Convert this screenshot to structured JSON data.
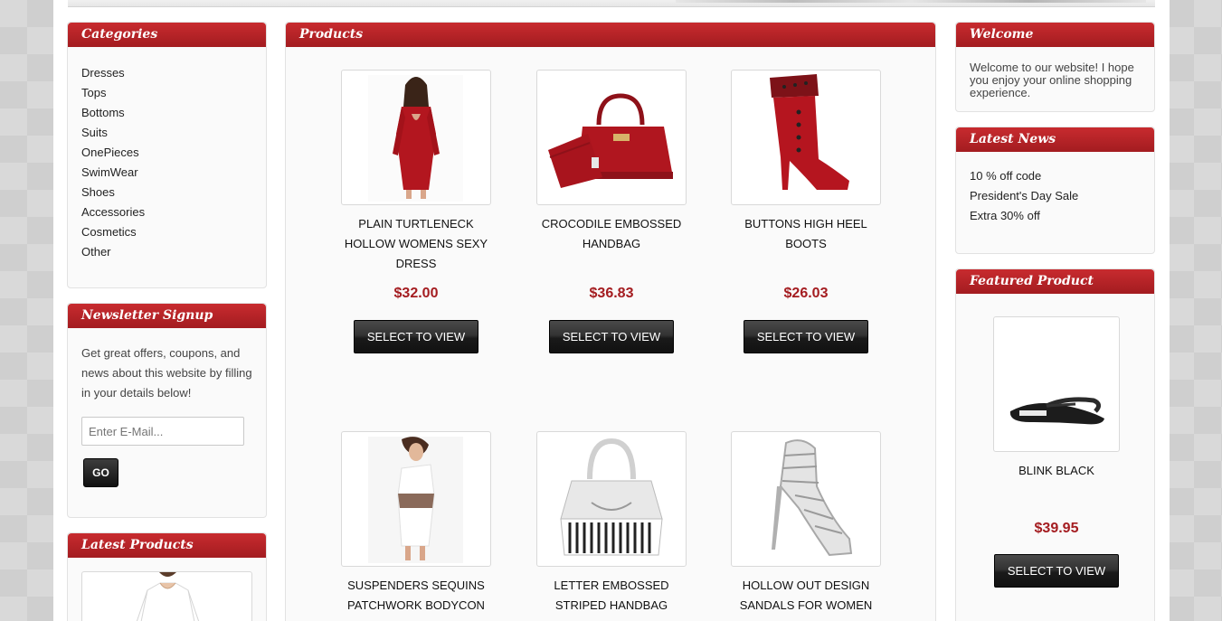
{
  "sidebar_left": {
    "categories": {
      "title": "Categories",
      "items": [
        "Dresses",
        "Tops",
        "Bottoms",
        "Suits",
        "OnePieces",
        "SwimWear",
        "Shoes",
        "Accessories",
        "Cosmetics",
        "Other"
      ]
    },
    "newsletter": {
      "title": "Newsletter Signup",
      "text": "Get great offers, coupons, and news about this website by filling in your details below!",
      "email_placeholder": "Enter E-Mail...",
      "go_label": "GO"
    },
    "latest_products": {
      "title": "Latest Products"
    }
  },
  "products": {
    "title": "Products",
    "button_label": "SELECT TO VIEW",
    "items": [
      {
        "name": "PLAIN TURTLENECK HOLLOW WOMENS SEXY DRESS",
        "price": "$32.00",
        "icon": "red-dress-image"
      },
      {
        "name": "CROCODILE EMBOSSED HANDBAG",
        "price": "$36.83",
        "icon": "red-handbag-image"
      },
      {
        "name": "BUTTONS HIGH HEEL BOOTS",
        "price": "$26.03",
        "icon": "red-boot-image"
      },
      {
        "name": "SUSPENDERS SEQUINS PATCHWORK BODYCON",
        "price": "",
        "icon": "white-dress-image"
      },
      {
        "name": "LETTER EMBOSSED STRIPED HANDBAG",
        "price": "",
        "icon": "striped-handbag-image"
      },
      {
        "name": "HOLLOW OUT DESIGN SANDALS FOR WOMEN",
        "price": "",
        "icon": "silver-sandal-image"
      }
    ]
  },
  "sidebar_right": {
    "welcome": {
      "title": "Welcome",
      "text": "Welcome to our website! I hope you enjoy your online shopping experience."
    },
    "latest_news": {
      "title": "Latest News",
      "items": [
        "10 % off code",
        "President's Day Sale",
        "Extra 30% off"
      ]
    },
    "featured": {
      "title": "Featured Product",
      "name": "BLINK BLACK",
      "price": "$39.95",
      "button_label": "SELECT TO VIEW",
      "icon": "black-flip-flop-image"
    }
  },
  "colors": {
    "header_red": "#b22226",
    "price_red": "#a41c20",
    "button_black": "#1a1a1a"
  }
}
